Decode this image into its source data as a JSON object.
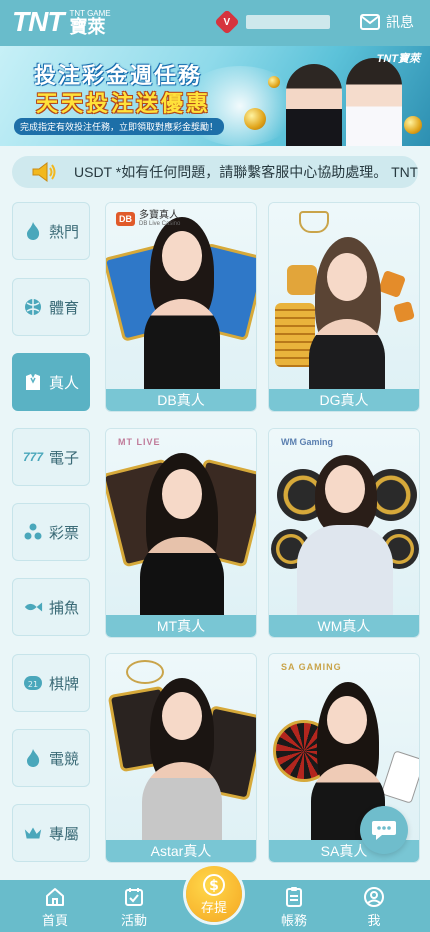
{
  "header": {
    "logo_main": "TNT",
    "logo_sub": "TNT GAME",
    "logo_cn": "寶萊",
    "vip_badge": "V",
    "messages_label": "訊息"
  },
  "banner": {
    "title_line1": "投注彩金週任務",
    "title_line2": "天天投注送優惠",
    "caption": "完成指定有效投注任務，立即領取對應彩金獎勵！",
    "brand": "TNT寶萊"
  },
  "marquee": {
    "text": "USDT *如有任何問題，請聯繫客服中心協助處理。 TNT寶萊"
  },
  "sidebar": {
    "items": [
      {
        "label": "熱門",
        "icon": "flame-icon"
      },
      {
        "label": "體育",
        "icon": "ball-icon"
      },
      {
        "label": "真人",
        "icon": "dealer-icon"
      },
      {
        "label": "電子",
        "icon": "slot-777-icon"
      },
      {
        "label": "彩票",
        "icon": "lottery-balls-icon"
      },
      {
        "label": "捕魚",
        "icon": "fish-icon"
      },
      {
        "label": "棋牌",
        "icon": "mahjong-icon"
      },
      {
        "label": "電競",
        "icon": "flame-icon"
      },
      {
        "label": "專屬",
        "icon": "crown-icon"
      }
    ],
    "active": "真人"
  },
  "games": [
    {
      "label": "DB真人",
      "provider": "多寶真人",
      "provider_sub": "DB Live Casino"
    },
    {
      "label": "DG真人",
      "provider": ""
    },
    {
      "label": "MT真人",
      "provider": "MT LIVE"
    },
    {
      "label": "WM真人",
      "provider": "WM Gaming"
    },
    {
      "label": "Astar真人",
      "provider": ""
    },
    {
      "label": "SA真人",
      "provider": "SA GAMING"
    }
  ],
  "bottom_nav": {
    "home": "首頁",
    "events": "活動",
    "deposit": "存提",
    "account": "帳務",
    "me": "我"
  },
  "colors": {
    "primary": "#69bccb",
    "active": "#5ab2c4",
    "deposit": "#f5a622",
    "vip": "#d6343e"
  }
}
